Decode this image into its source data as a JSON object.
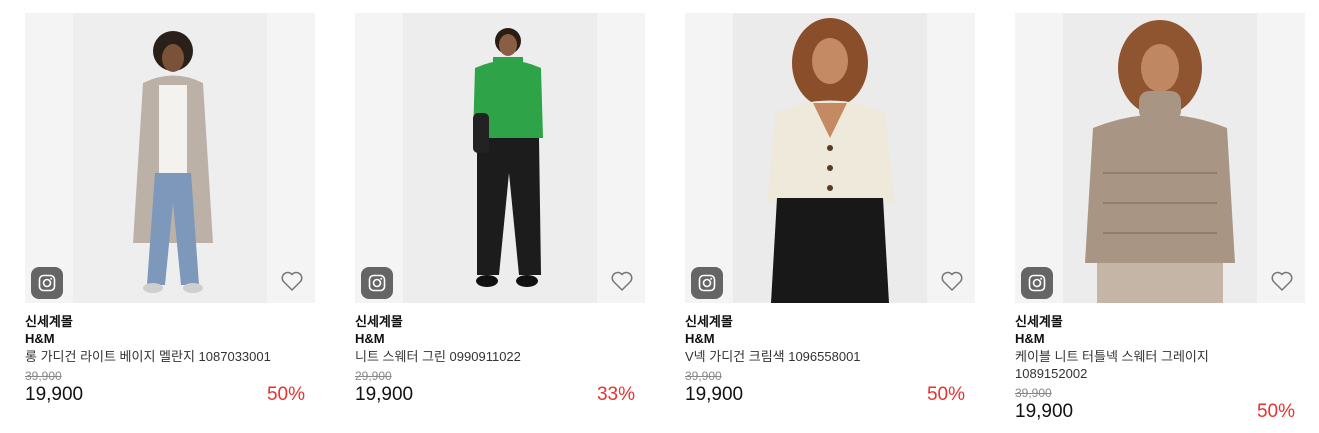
{
  "products": [
    {
      "shop": "신세계몰",
      "brand": "H&M",
      "name": "롱 가디건 라이트 베이지 멜란지 1087033001",
      "original_price": "39,900",
      "price": "19,900",
      "discount": "50%",
      "icons": [
        "instagram-icon",
        "heart-outline-icon"
      ]
    },
    {
      "shop": "신세계몰",
      "brand": "H&M",
      "name": "니트 스웨터 그린 0990911022",
      "original_price": "29,900",
      "price": "19,900",
      "discount": "33%",
      "icons": [
        "instagram-icon",
        "heart-outline-icon"
      ]
    },
    {
      "shop": "신세계몰",
      "brand": "H&M",
      "name": "V넥 가디건 크림색 1096558001",
      "original_price": "39,900",
      "price": "19,900",
      "discount": "50%",
      "icons": [
        "instagram-icon",
        "heart-outline-icon"
      ]
    },
    {
      "shop": "신세계몰",
      "brand": "H&M",
      "name": "케이블 니트 터틀넥 스웨터 그레이지 1089152002",
      "original_price": "39,900",
      "price": "19,900",
      "discount": "50%",
      "icons": [
        "instagram-icon",
        "heart-outline-icon"
      ]
    }
  ],
  "colors": {
    "discount": "#e8322d",
    "strike_price": "#888888",
    "image_bg": "#f4f4f4",
    "insta_badge": "#464646"
  }
}
